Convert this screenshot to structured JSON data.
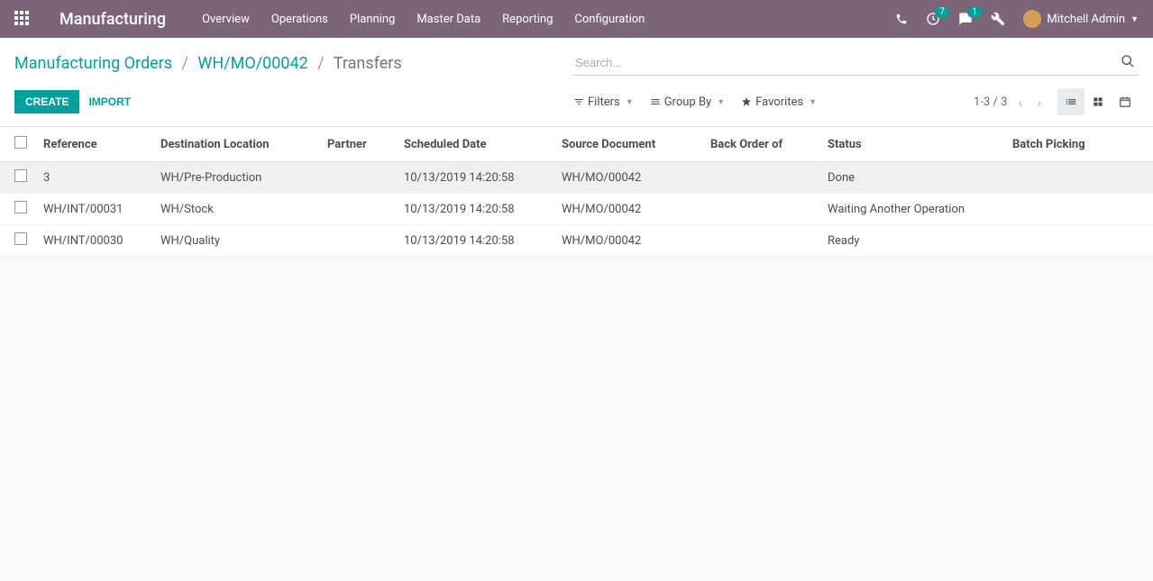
{
  "navbar": {
    "brand": "Manufacturing",
    "menu": [
      "Overview",
      "Operations",
      "Planning",
      "Master Data",
      "Reporting",
      "Configuration"
    ],
    "activities_badge": "7",
    "messages_badge": "1",
    "user_name": "Mitchell Admin"
  },
  "breadcrumb": {
    "root": "Manufacturing Orders",
    "mid": "WH/MO/00042",
    "current": "Transfers"
  },
  "search": {
    "placeholder": "Search..."
  },
  "buttons": {
    "create": "Create",
    "import": "Import"
  },
  "filters": {
    "filters": "Filters",
    "groupby": "Group By",
    "favorites": "Favorites"
  },
  "pager": {
    "range": "1-3 / 3"
  },
  "columns": {
    "reference": "Reference",
    "destination": "Destination Location",
    "partner": "Partner",
    "scheduled": "Scheduled Date",
    "source": "Source Document",
    "backorder": "Back Order of",
    "status": "Status",
    "batch": "Batch Picking"
  },
  "rows": [
    {
      "reference": "3",
      "destination": "WH/Pre-Production",
      "partner": "",
      "scheduled": "10/13/2019 14:20:58",
      "source": "WH/MO/00042",
      "backorder": "",
      "status": "Done",
      "batch": ""
    },
    {
      "reference": "WH/INT/00031",
      "destination": "WH/Stock",
      "partner": "",
      "scheduled": "10/13/2019 14:20:58",
      "source": "WH/MO/00042",
      "backorder": "",
      "status": "Waiting Another Operation",
      "batch": ""
    },
    {
      "reference": "WH/INT/00030",
      "destination": "WH/Quality",
      "partner": "",
      "scheduled": "10/13/2019 14:20:58",
      "source": "WH/MO/00042",
      "backorder": "",
      "status": "Ready",
      "batch": ""
    }
  ]
}
